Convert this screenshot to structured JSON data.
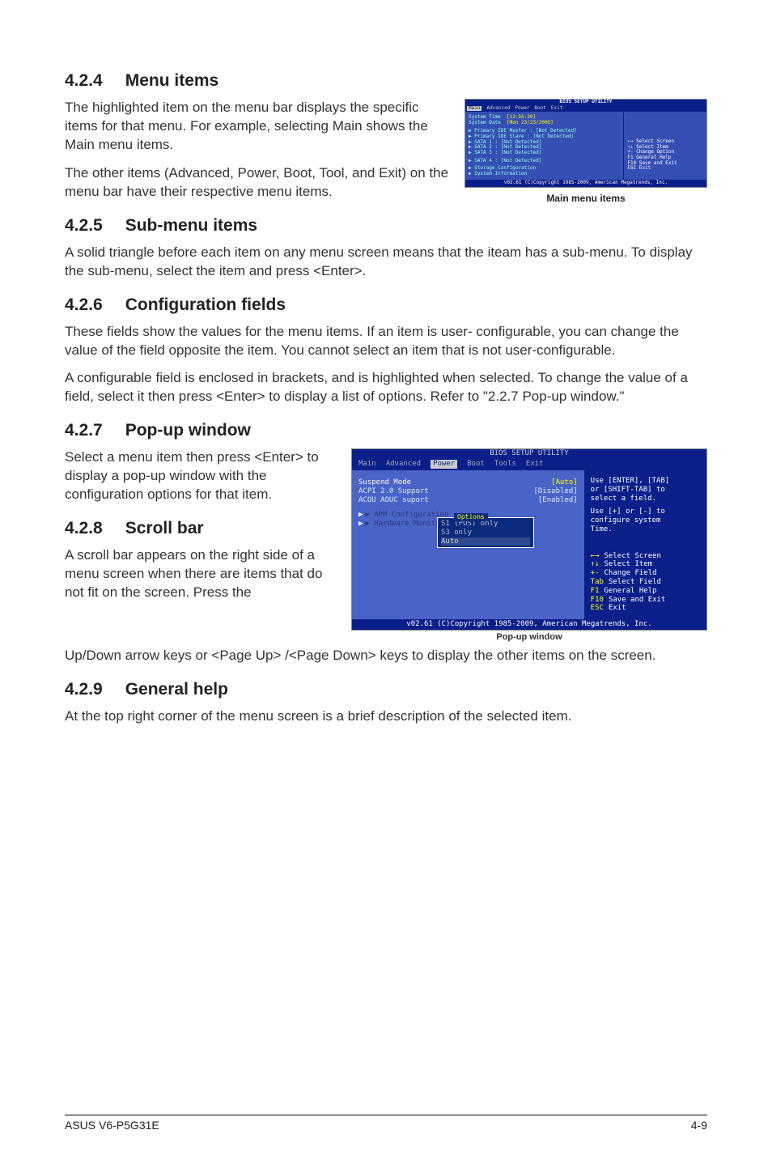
{
  "sections": {
    "s424": {
      "num": "4.2.4",
      "title": "Menu items",
      "p1": "The highlighted item on the menu bar  displays the specific items for that menu. For example, selecting Main shows the Main menu items.",
      "p2": "The other items (Advanced, Power, Boot, Tool, and Exit) on the menu bar have their respective menu items."
    },
    "s425": {
      "num": "4.2.5",
      "title": "Sub-menu items",
      "p1": "A solid triangle before each item on any menu screen means that the iteam has a sub-menu. To display the sub-menu, select the item and press <Enter>."
    },
    "s426": {
      "num": "4.2.6",
      "title": "Configuration fields",
      "p1": "These fields show the values for the menu items. If an item is user- configurable, you can change the value of the field opposite the item. You cannot select an item that is not user-configurable.",
      "p2": "A configurable field is enclosed in brackets, and is highlighted when selected. To change the value of a field, select it then press <Enter> to display a list of options. Refer to \"2.2.7 Pop-up window.\""
    },
    "s427": {
      "num": "4.2.7",
      "title": "Pop-up window",
      "p1": "Select a menu item then press <Enter> to display a pop-up window with the configuration options for that item."
    },
    "s428": {
      "num": "4.2.8",
      "title": "Scroll bar",
      "p1": "A scroll bar appears on the right side of a menu screen when there are items that do not fit on the screen. Press the",
      "p2": "Up/Down arrow keys or <Page Up> /<Page Down> keys to display the other items on the screen."
    },
    "s429": {
      "num": "4.2.9",
      "title": "General help",
      "p1": "At the top right corner of the menu screen is a brief description of the selected item."
    }
  },
  "mini": {
    "caption": "Main menu items",
    "title": "BIOS SETUP UTILITY",
    "tabs": [
      "Main",
      "Advanced",
      "Power",
      "Boot",
      "Exit"
    ],
    "left": {
      "time_k": "System Time",
      "time_v": "[12:56:30]",
      "date_k": "System Date",
      "date_v": "[Mon 23/23/2008]",
      "pm_k": "▶  Primary IDE Master",
      "pm_v": ": [Not Detected]",
      "ps_k": "▶  Primary IDE Slave",
      "ps_v": ": [Not Detected]",
      "s1_k": "▶  SATA 1",
      "s1_v": ": [Not Detected]",
      "s2_k": "▶  SATA 2",
      "s2_v": ": [Not Detected]",
      "s3_k": "▶  SATA 3",
      "s3_v": ": [Not Detected]",
      "s4_k": "▶  SATA 4",
      "s4_v": ": [Not Detected]",
      "storage": "▶  Storage Configuration",
      "sysinfo": "▶  System Information"
    },
    "right": {
      "l1": "←→   Select Screen",
      "l2": "↑↓   Select Item",
      "l3": "+-   Change Option",
      "l4": "F1   General Help",
      "l5": "F10  Save and Exit",
      "l6": "ESC  Exit"
    },
    "foot": "v02.61 (C)Copyright 1985-2009, American Megatrends, Inc."
  },
  "popup": {
    "caption": "Pop-up window",
    "title": "BIOS SETUP UTILITY",
    "tabs": [
      "Main",
      "Advanced",
      "Power",
      "Boot",
      "Tools",
      "Exit"
    ],
    "left": {
      "r1k": "Suspend Mode",
      "r1v": "[Auto]",
      "r2k": "ACPI 2.0 Support",
      "r2v": "[Disabled]",
      "r3k": "ACOU AOUC suport",
      "r3v": "[Enabled]",
      "r4": "▶  APM Configuration",
      "r5": "▶  Hardware Monitor"
    },
    "options": {
      "title": "Options",
      "o1": "S1 (POS) only",
      "o2": "S3 only",
      "o3": "Auto"
    },
    "right": {
      "h1": "Use [ENTER], [TAB]",
      "h2": "or [SHIFT-TAB] to",
      "h3": "select a field.",
      "h4": "Use [+] or [-] to",
      "h5": "configure system",
      "h6": "Time.",
      "k1a": "←→",
      "k1b": "Select Screen",
      "k2a": "↑↓",
      "k2b": "Select Item",
      "k3a": "+-",
      "k3b": "Change Field",
      "k4a": "Tab",
      "k4b": "Select Field",
      "k5a": "F1",
      "k5b": "General Help",
      "k6a": "F10",
      "k6b": "Save and Exit",
      "k7a": "ESC",
      "k7b": "Exit"
    },
    "foot": "v02.61 (C)Copyright 1985-2009, American Megatrends, Inc."
  },
  "footer": {
    "left": "ASUS V6-P5G31E",
    "right": "4-9"
  }
}
